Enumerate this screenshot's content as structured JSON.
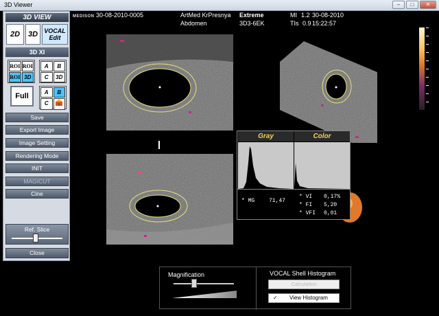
{
  "window": {
    "title": "3D Viewer",
    "buttons": [
      "–",
      "□",
      "✕"
    ]
  },
  "panel": {
    "title": "3D VIEW",
    "mode_buttons": [
      "2D",
      "3D"
    ],
    "vocal": {
      "line1": "VOCAL",
      "line2": "Edit"
    },
    "section": "3D XI",
    "roi_grid": [
      "ROI",
      "ROI",
      "ROI",
      "3D"
    ],
    "view_grid": [
      "A",
      "B",
      "C",
      "3D"
    ],
    "full_label": "Full",
    "layout_grid": [
      "A",
      "B",
      "C",
      ""
    ],
    "actions": [
      "Save",
      "Export Image",
      "Image Setting",
      "Rendering Mode",
      "INIT",
      "MAGICUT",
      "Cine"
    ],
    "ref_slice_label": "Ref. Slice",
    "close_label": "Close"
  },
  "header": {
    "logo": "MEDISON",
    "patient_id": "30-08-2010-0005",
    "institution": "ArtMed KrPresnya",
    "exam": "Abdomen",
    "preset": "Extreme",
    "probe": "3D3-6EK",
    "mi_label": "MI",
    "mi_value": "1.2",
    "tis_label": "TIs",
    "tis_value": "0.9",
    "date": "30-08-2010",
    "time": "15:22:57"
  },
  "histogram": {
    "gray_title": "Gray",
    "color_title": "Color",
    "mg_label": "* MG",
    "mg_value": "71,47",
    "vi_label": "* VI",
    "vi_value": "0,17%",
    "fi_label": "* FI",
    "fi_value": "5,20",
    "vfi_label": "* VFI",
    "vfi_value": "0,01"
  },
  "bottom": {
    "magnification_label": "Magnification",
    "vocal_title": "VOCAL Shell Histogram",
    "calculation_label": "Calculation",
    "view_histogram_label": "View Histogram",
    "view_histogram_checked": "✓"
  },
  "colors": {
    "panel_bg": "#d6dbe3",
    "accent": "#4cc3ff",
    "contour": "#e8e27a",
    "flow": "#c02d8a"
  }
}
